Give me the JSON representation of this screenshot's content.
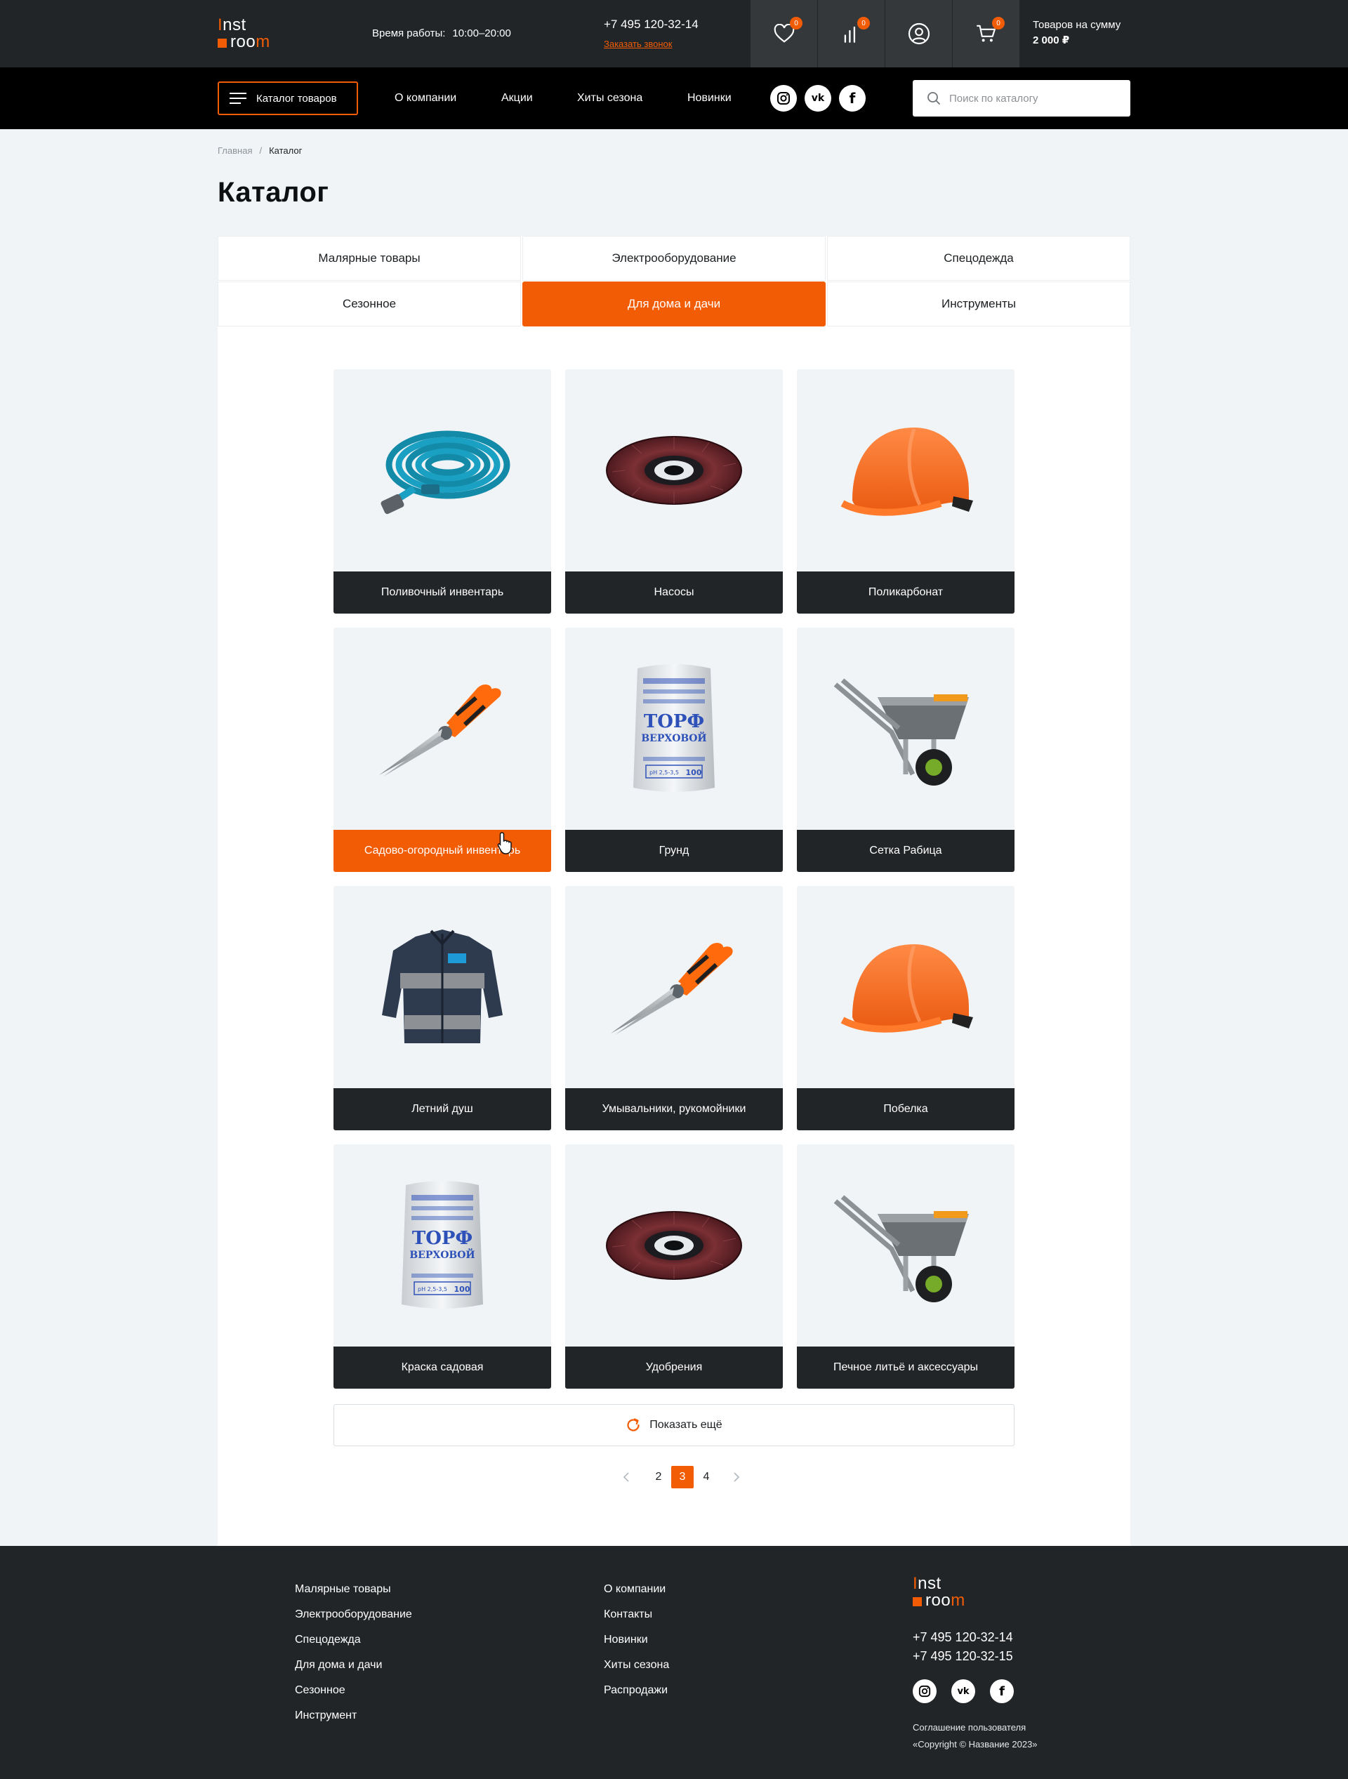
{
  "brand": {
    "logo_line1": "Inst",
    "logo_line2": "room",
    "accent": "#f25c05"
  },
  "header": {
    "hours_label": "Время работы:",
    "hours_value": "10:00–20:00",
    "phone": "+7 495 120-32-14",
    "callback_link": "Заказать звонок",
    "wishlist_count": "0",
    "compare_count": "0",
    "cart_count": "0",
    "cart_total_label": "Товаров на сумму",
    "cart_total_value": "2 000 ₽"
  },
  "nav": {
    "catalog_button": "Каталог товаров",
    "links": [
      "О компании",
      "Акции",
      "Хиты сезона",
      "Новинки"
    ],
    "socials": [
      "instagram-icon",
      "vk-icon",
      "facebook-icon"
    ],
    "search_placeholder": "Поиск по каталогу"
  },
  "breadcrumb": {
    "home": "Главная",
    "separator": "/",
    "current": "Каталог"
  },
  "page_title": "Каталог",
  "tabs": [
    {
      "label": "Малярные товары",
      "active": false
    },
    {
      "label": "Электрооборудование",
      "active": false
    },
    {
      "label": "Спецодежда",
      "active": false
    },
    {
      "label": "Сезонное",
      "active": false
    },
    {
      "label": "Для дома и дачи",
      "active": true
    },
    {
      "label": "Инструменты",
      "active": false
    }
  ],
  "categories": [
    {
      "label": "Поливочный инвентарь",
      "image": "garden-hose",
      "highlighted": false
    },
    {
      "label": "Насосы",
      "image": "flap-disc",
      "highlighted": false
    },
    {
      "label": "Поликарбонат",
      "image": "hard-hat",
      "highlighted": false
    },
    {
      "label": "Садово-огородный инвентарь",
      "image": "tin-snips",
      "highlighted": true
    },
    {
      "label": "Грунд",
      "image": "peat-bag",
      "highlighted": false
    },
    {
      "label": "Сетка Рабица",
      "image": "wheelbarrow",
      "highlighted": false
    },
    {
      "label": "Летний душ",
      "image": "work-jacket",
      "highlighted": false
    },
    {
      "label": "Умывальники, рукомойники",
      "image": "tin-snips",
      "highlighted": false
    },
    {
      "label": "Побелка",
      "image": "hard-hat",
      "highlighted": false
    },
    {
      "label": "Краска садовая",
      "image": "peat-bag",
      "highlighted": false
    },
    {
      "label": "Удобрения",
      "image": "flap-disc",
      "highlighted": false
    },
    {
      "label": "Печное литьё и аксессуары",
      "image": "wheelbarrow",
      "highlighted": false
    }
  ],
  "peat_bag_text": {
    "word1": "ТОРФ",
    "word2": "ВЕРХОВОЙ",
    "small": "pH 2,5-3,5",
    "volume": "100"
  },
  "show_more": "Показать ещё",
  "pagination": {
    "pages": [
      "2",
      "3",
      "4"
    ],
    "current": "3"
  },
  "footer": {
    "col1": [
      "Малярные товары",
      "Электрооборудование",
      "Спецодежда",
      "Для дома и дачи",
      "Сезонное",
      "Инструмент"
    ],
    "col2": [
      "О компании",
      "Контакты",
      "Новинки",
      "Хиты сезона",
      "Распродажи"
    ],
    "phones": [
      "+7 495 120-32-14",
      "+7 495 120-32-15"
    ],
    "agreement": "Соглашение пользователя",
    "copyright": "«Copyright © Название 2023»"
  }
}
